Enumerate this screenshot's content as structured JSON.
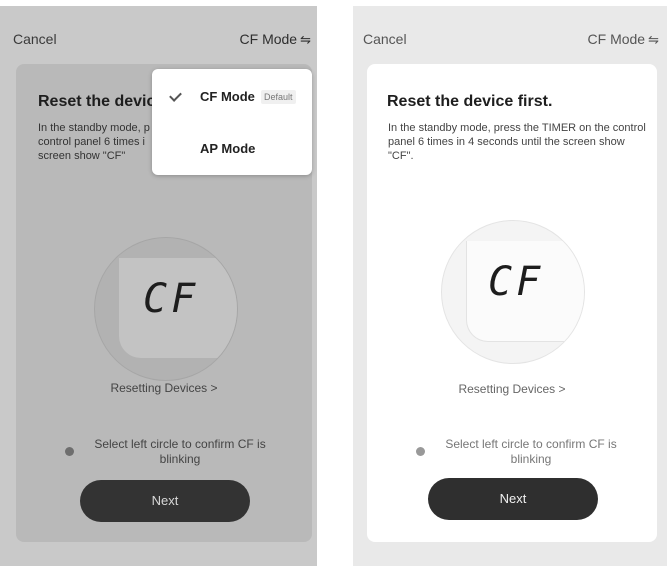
{
  "left_screen": {
    "topbar": {
      "cancel_label": "Cancel",
      "mode_label": "CF Mode",
      "mode_icon": "⇋"
    },
    "card": {
      "title": "Reset the devic",
      "description": "In the standby mode, p\ncontrol panel 6 times i\nscreen show \"CF\"",
      "display_text": "CF",
      "resetting_link": "Resetting Devices >",
      "confirm_text": "Select left circle to confirm CF is blinking",
      "next_label": "Next"
    },
    "dropdown": {
      "items": [
        {
          "label": "CF Mode",
          "badge": "Default",
          "selected": true
        },
        {
          "label": "AP Mode",
          "selected": false
        }
      ]
    }
  },
  "right_screen": {
    "topbar": {
      "cancel_label": "Cancel",
      "mode_label": "CF Mode",
      "mode_icon": "⇋"
    },
    "card": {
      "title": "Reset the device first.",
      "description": "In the standby mode, press the TIMER on the control panel 6 times in 4 seconds until the screen show \"CF\".",
      "display_text": "CF",
      "resetting_link": "Resetting Devices >",
      "confirm_text": "Select left circle to confirm CF is blinking",
      "next_label": "Next"
    }
  },
  "colors": {
    "left_background": "#c9c9c9",
    "left_card": "#b9b9b9",
    "right_card": "#ffffff",
    "button": "#333333"
  }
}
